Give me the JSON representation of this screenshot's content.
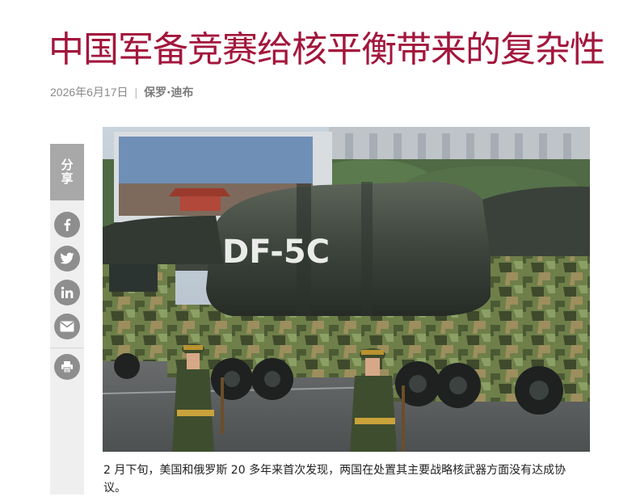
{
  "article": {
    "title": "中国军备竞赛给核平衡带来的复杂性",
    "date": "2026年6月17日",
    "separator": "|",
    "author": "保罗·迪布",
    "caption": "2 月下旬，美国和俄罗斯 20 多年来首次发现，两国在处置其主要战略核武器方面没有达成协议。"
  },
  "share": {
    "label": "分享",
    "buttons": [
      {
        "icon": "facebook-icon"
      },
      {
        "icon": "twitter-icon"
      },
      {
        "icon": "linkedin-icon"
      },
      {
        "icon": "email-icon"
      },
      {
        "icon": "print-icon"
      }
    ]
  },
  "photo": {
    "missile_marking": "DF-5C"
  },
  "colors": {
    "title": "#a3163c",
    "share_bg": "#efefef",
    "share_tab": "#a8a8a8",
    "share_icon": "#8e8e8e"
  }
}
